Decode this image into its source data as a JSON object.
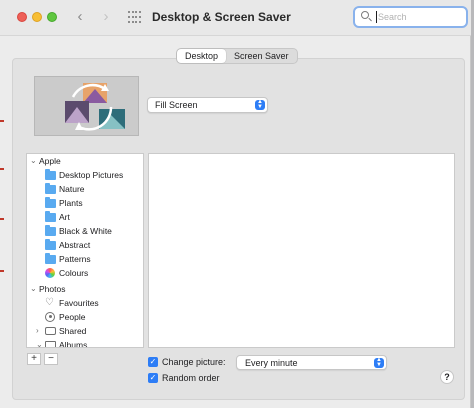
{
  "window": {
    "title": "Desktop & Screen Saver"
  },
  "toolbar": {
    "back_icon": "chevron-left-icon",
    "forward_icon": "chevron-right-icon",
    "show_all_icon": "grid-icon",
    "search_placeholder": "Search"
  },
  "tabs": [
    {
      "label": "Desktop",
      "active": true
    },
    {
      "label": "Screen Saver",
      "active": false
    }
  ],
  "desktop": {
    "fill_mode": "Fill Screen"
  },
  "sidebar": {
    "groups": [
      {
        "label": "Apple",
        "expanded": true,
        "items": [
          "Desktop Pictures",
          "Nature",
          "Plants",
          "Art",
          "Black & White",
          "Abstract",
          "Patterns",
          "Colours"
        ]
      },
      {
        "label": "Photos",
        "expanded": true,
        "items": [
          "Favourites",
          "People",
          "Shared",
          "Albums"
        ]
      }
    ],
    "add_label": "+",
    "remove_label": "−"
  },
  "options": {
    "change_picture_label": "Change picture:",
    "change_picture_checked": true,
    "interval_value": "Every minute",
    "random_order_label": "Random order",
    "random_order_checked": true
  },
  "help_label": "?",
  "colors": {
    "accent": "#2d7df6",
    "folder": "#59aaf0",
    "focus_ring": "#89b2ec"
  }
}
